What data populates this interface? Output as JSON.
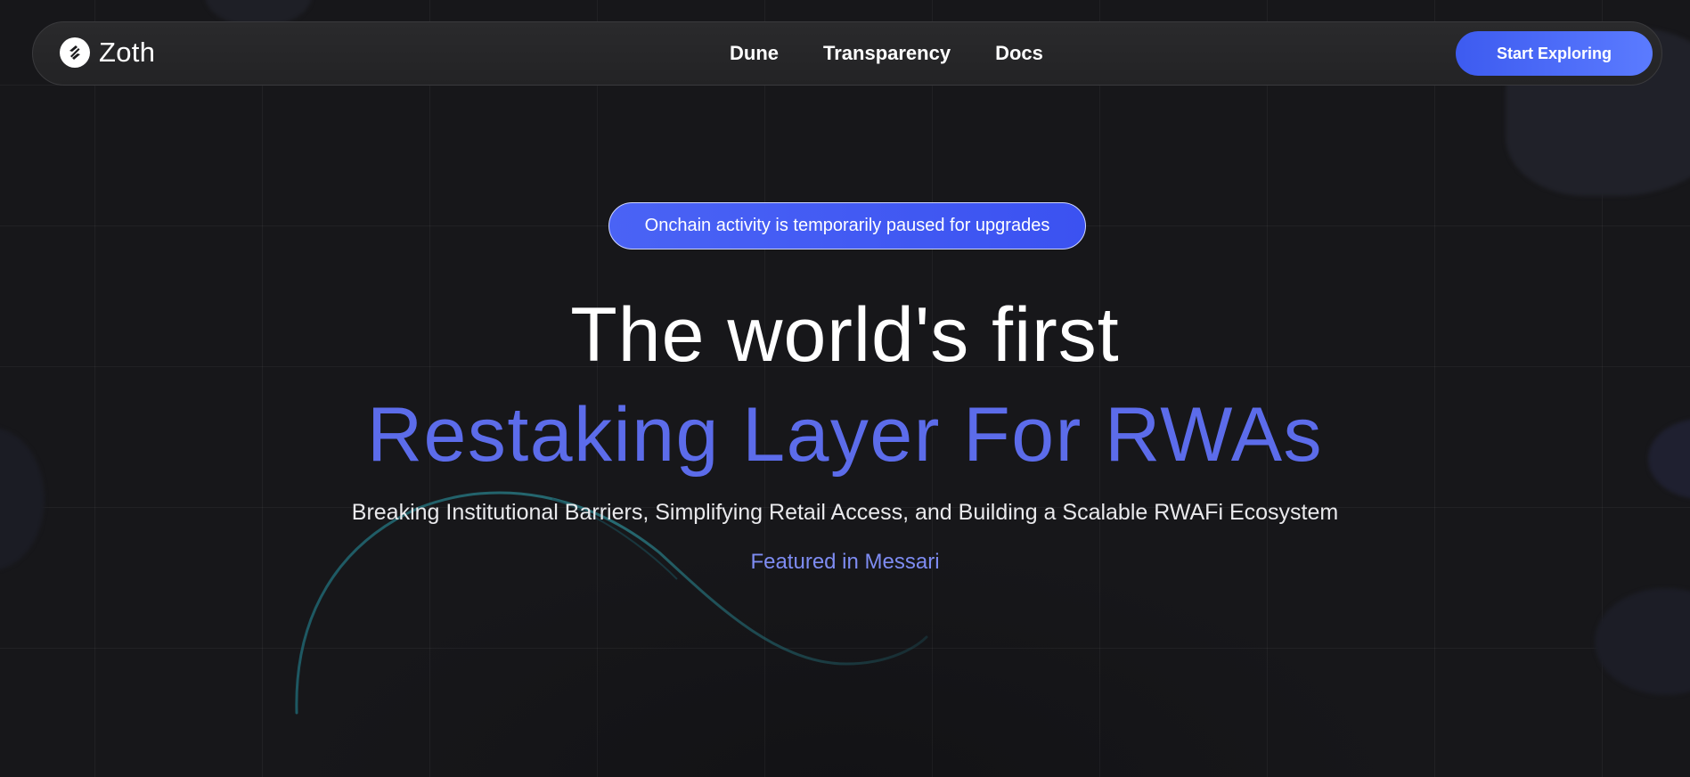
{
  "nav": {
    "brand": "Zoth",
    "links": [
      "Dune",
      "Transparency",
      "Docs"
    ],
    "cta_label": "Start Exploring"
  },
  "hero": {
    "notice": "Onchain activity is temporarily paused for upgrades",
    "headline_line1": "The world's first",
    "headline_line2": "Restaking Layer For RWAs",
    "subtitle": "Breaking Institutional Barriers, Simplifying Retail Access, and Building a Scalable RWAFi Ecosystem",
    "featured": "Featured in Messari"
  },
  "colors": {
    "background": "#17171a",
    "accent": "#5c6cea",
    "button": "#4a63f5",
    "link_accent": "#7e8cf2"
  },
  "icons": {
    "brand_logo": "zoth-logo-icon"
  }
}
